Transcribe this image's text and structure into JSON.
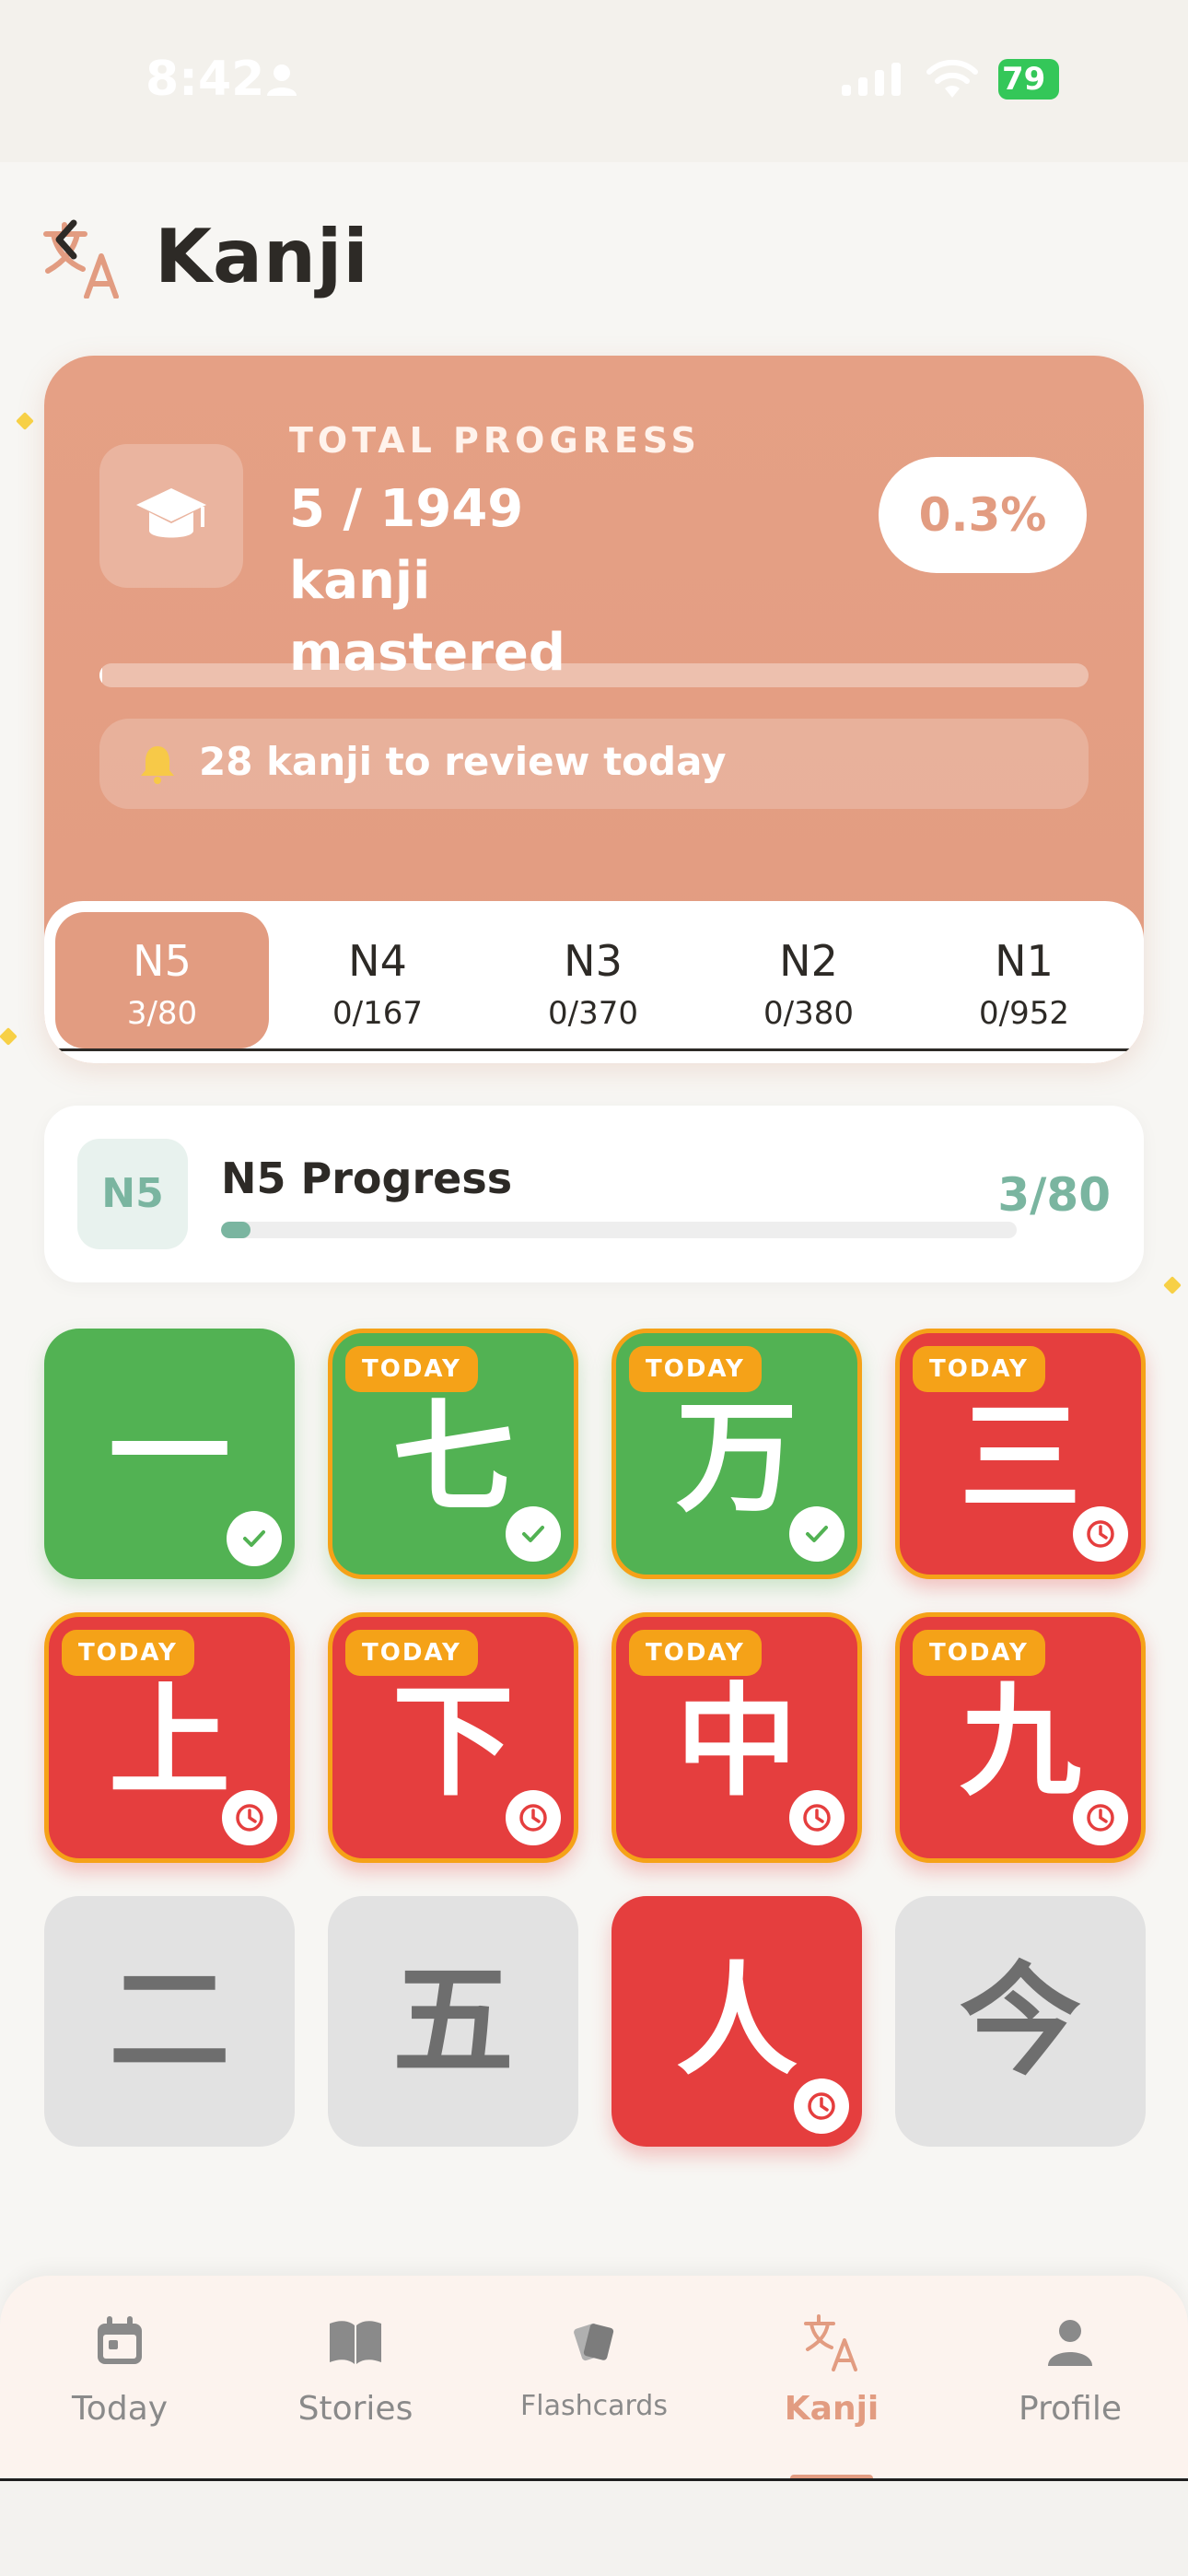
{
  "status_bar": {
    "time": "8:42",
    "battery": "79"
  },
  "header": {
    "title": "Kanji"
  },
  "hero": {
    "label": "TOTAL PROGRESS",
    "value": "5 / 1949 kanji mastered",
    "percent": "0.3%",
    "progress_fraction": 0.003,
    "review_text": "28 kanji to review today"
  },
  "levels": [
    {
      "name": "N5",
      "count": "3/80",
      "active": true
    },
    {
      "name": "N4",
      "count": "0/167",
      "active": false
    },
    {
      "name": "N3",
      "count": "0/370",
      "active": false
    },
    {
      "name": "N2",
      "count": "0/380",
      "active": false
    },
    {
      "name": "N1",
      "count": "0/952",
      "active": false
    }
  ],
  "level_progress": {
    "badge": "N5",
    "title": "N5 Progress",
    "count": "3/80",
    "progress_fraction": 0.0375
  },
  "today_label": "TODAY",
  "kanji": [
    {
      "char": "一",
      "state": "mastered",
      "today": false
    },
    {
      "char": "七",
      "state": "mastered",
      "today": true
    },
    {
      "char": "万",
      "state": "mastered",
      "today": true
    },
    {
      "char": "三",
      "state": "review",
      "today": true
    },
    {
      "char": "上",
      "state": "review",
      "today": true
    },
    {
      "char": "下",
      "state": "review",
      "today": true
    },
    {
      "char": "中",
      "state": "review",
      "today": true
    },
    {
      "char": "九",
      "state": "review",
      "today": true
    },
    {
      "char": "二",
      "state": "locked",
      "today": false
    },
    {
      "char": "五",
      "state": "locked",
      "today": false
    },
    {
      "char": "人",
      "state": "review",
      "today": false
    },
    {
      "char": "今",
      "state": "locked",
      "today": false
    }
  ],
  "tab_bar": [
    {
      "label": "Today",
      "icon": "calendar-icon",
      "active": false
    },
    {
      "label": "Stories",
      "icon": "book-icon",
      "active": false
    },
    {
      "label": "Flashcards",
      "icon": "cards-icon",
      "active": false
    },
    {
      "label": "Kanji",
      "icon": "translate-icon",
      "active": true
    },
    {
      "label": "Profile",
      "icon": "person-icon",
      "active": false
    }
  ],
  "colors": {
    "accent": "#e29c81",
    "mastered": "#52b253",
    "review": "#e53e3e",
    "locked": "#e2e2e2",
    "today_badge": "#f5a218",
    "level_progress": "#7ab5a0"
  }
}
